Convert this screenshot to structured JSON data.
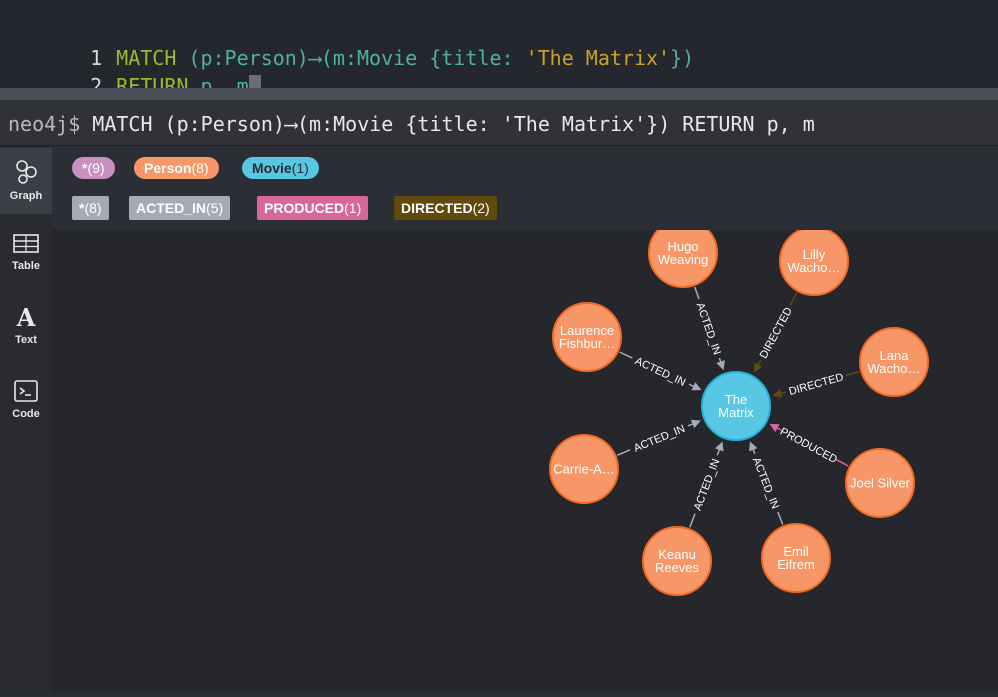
{
  "editor": {
    "lines": [
      {
        "num": "1",
        "parts": [
          {
            "cls": "kw",
            "text": "MATCH "
          },
          {
            "cls": "tx",
            "text": "(p:Person)⟶(m:Movie {title: "
          },
          {
            "cls": "st",
            "text": "'The Matrix'"
          },
          {
            "cls": "tx",
            "text": "})"
          }
        ]
      },
      {
        "num": "2",
        "parts": [
          {
            "cls": "kw",
            "text": "RETURN "
          },
          {
            "cls": "tx",
            "text": "p, m"
          }
        ]
      }
    ]
  },
  "frame": {
    "prompt": "neo4j$",
    "query": "MATCH (p:Person)⟶(m:Movie {title: 'The Matrix'}) RETURN p, m"
  },
  "sidebar": {
    "items": [
      {
        "label": "Graph",
        "icon": "graph-icon"
      },
      {
        "label": "Table",
        "icon": "table-icon"
      },
      {
        "label": "Text",
        "icon": "text-icon"
      },
      {
        "label": "Code",
        "icon": "code-icon"
      }
    ]
  },
  "legend": {
    "node_labels": [
      {
        "name": "*",
        "count": "(9)",
        "color": "#c990c0",
        "text_color": "#ffffff"
      },
      {
        "name": "Person",
        "count": "(8)",
        "color": "#f79767",
        "text_color": "#ffffff"
      },
      {
        "name": "Movie",
        "count": "(1)",
        "color": "#57c7e3",
        "text_color": "#2a2c33"
      }
    ],
    "rel_types": [
      {
        "name": "*",
        "count": "(8)",
        "color": "#a5abb6"
      },
      {
        "name": "ACTED_IN",
        "count": "(5)",
        "color": "#a5abb6"
      },
      {
        "name": "PRODUCED",
        "count": "(1)",
        "color": "#d9669b"
      },
      {
        "name": "DIRECTED",
        "count": "(2)",
        "color": "#604a0e"
      }
    ]
  },
  "graph": {
    "center": {
      "id": "matrix",
      "lines": [
        "The",
        "Matrix"
      ],
      "color": "#57c7e3",
      "stroke": "#23b3d7"
    },
    "person_color": "#f79767",
    "person_stroke": "#f36924",
    "nodes": [
      {
        "id": "hugo",
        "lines": [
          "Hugo",
          "Weaving"
        ],
        "rel": "ACTED_IN",
        "rel_color": "#a5abb6"
      },
      {
        "id": "lilly",
        "lines": [
          "Lilly",
          "Wacho…"
        ],
        "rel": "DIRECTED",
        "rel_color": "#604a0e"
      },
      {
        "id": "laurence",
        "lines": [
          "Laurence",
          "Fishbur…"
        ],
        "rel": "ACTED_IN",
        "rel_color": "#a5abb6"
      },
      {
        "id": "lana",
        "lines": [
          "Lana",
          "Wacho…"
        ],
        "rel": "DIRECTED",
        "rel_color": "#604a0e"
      },
      {
        "id": "carrie",
        "lines": [
          "Carrie-A…"
        ],
        "rel": "ACTED_IN",
        "rel_color": "#a5abb6"
      },
      {
        "id": "joel",
        "lines": [
          "Joel Silver"
        ],
        "rel": "PRODUCED",
        "rel_color": "#d9669b"
      },
      {
        "id": "keanu",
        "lines": [
          "Keanu",
          "Reeves"
        ],
        "rel": "ACTED_IN",
        "rel_color": "#a5abb6"
      },
      {
        "id": "emil",
        "lines": [
          "Emil",
          "Eifrem"
        ],
        "rel": "ACTED_IN",
        "rel_color": "#a5abb6"
      }
    ]
  }
}
